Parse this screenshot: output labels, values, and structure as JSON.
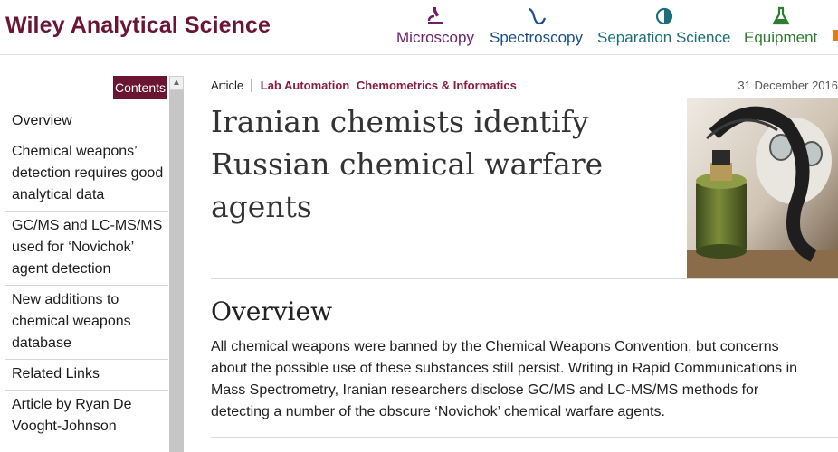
{
  "header": {
    "logo": "Wiley Analytical Science",
    "nav": [
      {
        "label": "Microscopy",
        "icon": "microscope-icon",
        "color": "#6e1e6e"
      },
      {
        "label": "Spectroscopy",
        "icon": "spectrum-wave-icon",
        "color": "#1a4e8a"
      },
      {
        "label": "Separation Science",
        "icon": "half-circle-drop-icon",
        "color": "#1a6f7a"
      },
      {
        "label": "Equipment",
        "icon": "flask-icon",
        "color": "#2e7d32"
      }
    ]
  },
  "sidebar": {
    "contents_label": "Contents",
    "items": [
      {
        "label": "Overview"
      },
      {
        "label": "Chemical weapons’ detection requires good analytical data"
      },
      {
        "label": "GC/MS and LC-MS/MS used for ‘Novichok’ agent detection"
      },
      {
        "label": "New additions to chemical weapons database"
      },
      {
        "label": "Related Links"
      },
      {
        "label": "Article by Ryan De Vooght-Johnson"
      }
    ]
  },
  "article": {
    "type": "Article",
    "tags": [
      "Lab Automation",
      "Chemometrics & Informatics"
    ],
    "date": "31 December 2016",
    "title": "Iranian chemists identify Russian chemical warfare agents",
    "section_heading": "Overview",
    "paragraph": "All chemical weapons were banned by the Chemical Weapons Convention, but concerns about the possible use of these substances still persist. Writing in Rapid Communications in Mass Spectrometry, Iranian researchers disclose GC/MS and LC-MS/MS methods for detecting a number of the obscure ‘Novichok’ chemical warfare agents."
  },
  "colors": {
    "brand": "#6b1533",
    "tag": "#8a1c3c"
  }
}
